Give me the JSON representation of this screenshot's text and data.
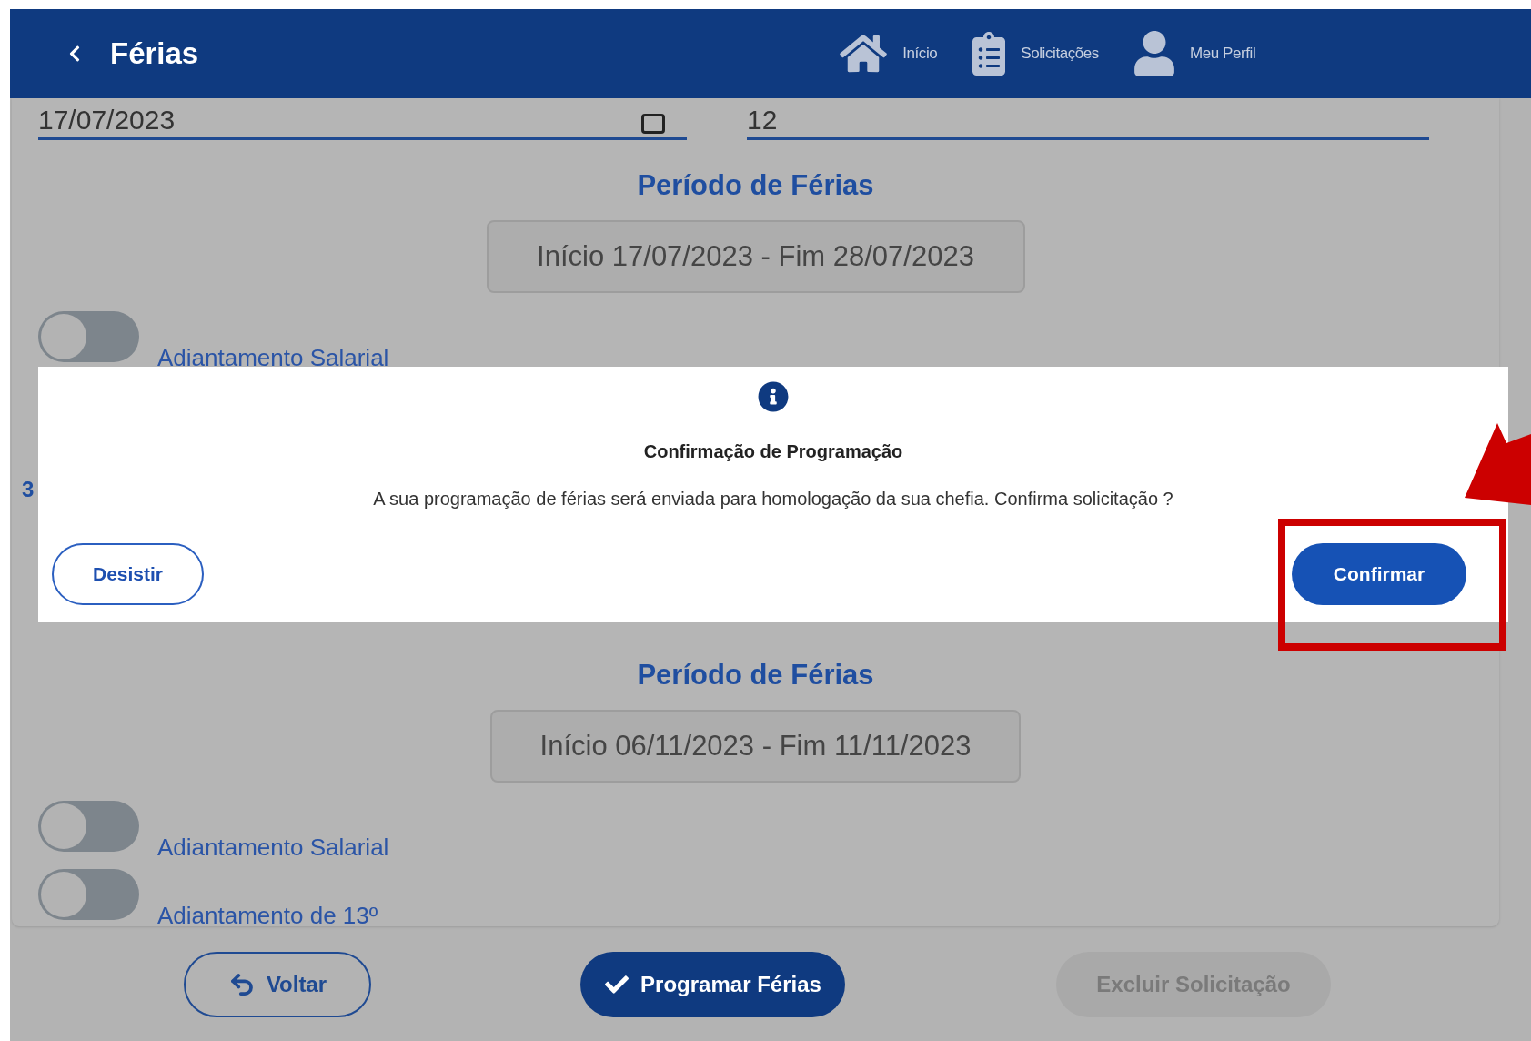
{
  "header": {
    "title": "Férias",
    "nav": [
      {
        "label": "Início"
      },
      {
        "label": "Solicitações"
      },
      {
        "label": "Meu Perfil"
      }
    ]
  },
  "sections": [
    {
      "fields": [
        {
          "value": "17/07/2023"
        },
        {
          "value": "12"
        }
      ],
      "heading": "Período de Férias",
      "range": "Início 17/07/2023 - Fim 28/07/2023",
      "toggles": [
        {
          "label": "Adiantamento Salarial",
          "on": false
        }
      ]
    },
    {
      "label": "3",
      "heading": "Período de Férias",
      "range": "Início 06/11/2023 - Fim 11/11/2023",
      "toggles": [
        {
          "label": "Adiantamento Salarial",
          "on": false
        },
        {
          "label": "Adiantamento de 13º",
          "on": false
        }
      ]
    }
  ],
  "dialog": {
    "title": "Confirmação de Programação",
    "message": "A sua programação de férias será enviada para homologação da sua chefia. Confirma solicitação ?",
    "buttons": [
      {
        "label": "Desistir",
        "kind": "outline"
      },
      {
        "label": "Confirmar",
        "kind": "primary"
      }
    ]
  },
  "footer": [
    {
      "label": "Voltar",
      "kind": "outline",
      "disabled": false
    },
    {
      "label": "Programar Férias",
      "kind": "primary",
      "disabled": false
    },
    {
      "label": "Excluir Solicitação",
      "kind": "pill",
      "disabled": true
    }
  ]
}
